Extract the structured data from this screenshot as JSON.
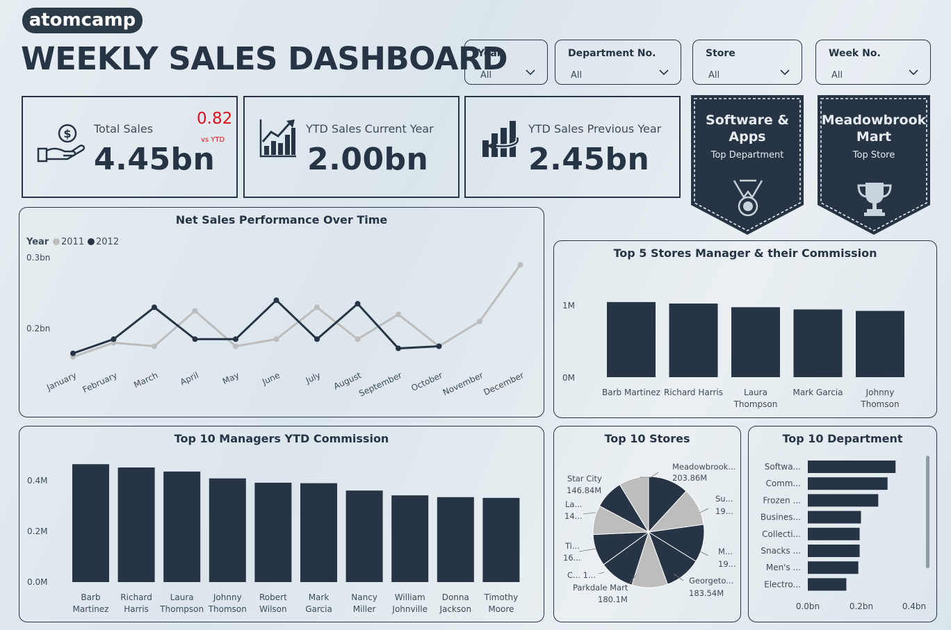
{
  "brand": "atomcamp",
  "title": "WEEKLY SALES DASHBOARD",
  "filters": [
    {
      "label": "Year",
      "value": "All"
    },
    {
      "label": "Department No.",
      "value": "All"
    },
    {
      "label": "Store",
      "value": "All"
    },
    {
      "label": "Week No.",
      "value": "All"
    }
  ],
  "kpis": {
    "total_sales": {
      "label": "Total Sales",
      "value": "4.45bn",
      "ratio": "0.82",
      "ratio_label": "vs YTD",
      "icon": "money-hand-icon"
    },
    "ytd_current": {
      "label": "YTD Sales Current Year",
      "value": "2.00bn",
      "icon": "growth-chart-icon"
    },
    "ytd_previous": {
      "label": "YTD Sales Previous Year",
      "value": "2.45bn",
      "icon": "decline-chart-icon"
    }
  },
  "banners": {
    "top_department": {
      "line1": "Software &",
      "line2": "Apps",
      "subtitle": "Top Department",
      "icon": "medal-icon"
    },
    "top_store": {
      "line1": "Meadowbrook",
      "line2": "Mart",
      "subtitle": "Top Store",
      "icon": "trophy-icon"
    }
  },
  "colors": {
    "dark": "#263445",
    "light": "#bdbdbd",
    "accent_red": "#e0101a"
  },
  "line_panel": {
    "title": "Net Sales Performance Over Time",
    "legend_title": "Year",
    "y_ticks": [
      "0.3bn",
      "0.2bn"
    ]
  },
  "stores5_panel": {
    "title": "Top 5 Stores Manager & their Commission",
    "y_ticks": [
      "1M",
      "0M"
    ],
    "labels": [
      [
        "Barb Martinez"
      ],
      [
        "Richard Harris"
      ],
      [
        "Laura",
        "Thompson"
      ],
      [
        "Mark Garcia"
      ],
      [
        "Johnny",
        "Thomson"
      ]
    ]
  },
  "managers10_panel": {
    "title": "Top 10 Managers YTD Commission",
    "y_ticks": [
      "0.4M",
      "0.2M",
      "0.0M"
    ],
    "labels": [
      [
        "Barb",
        "Martinez"
      ],
      [
        "Richard",
        "Harris"
      ],
      [
        "Laura",
        "Thompson"
      ],
      [
        "Johnny",
        "Thomson"
      ],
      [
        "Robert",
        "Wilson"
      ],
      [
        "Mark",
        "Garcia"
      ],
      [
        "Nancy",
        "Miller"
      ],
      [
        "William",
        "Johnville"
      ],
      [
        "Donna",
        "Jackson"
      ],
      [
        "Timothy",
        "Moore"
      ]
    ]
  },
  "stores10_panel": {
    "title": "Top 10 Stores",
    "slice_labels": [
      [
        "Meadowbrook...",
        "203.86M"
      ],
      [
        "Su...",
        "19..."
      ],
      [
        "M...",
        "19..."
      ],
      [
        "Georgeto...",
        "183.54M"
      ],
      [
        "Parkdale Mart",
        "180.1M"
      ],
      [
        "C... 1...",
        ""
      ],
      [
        "Ti...",
        "16..."
      ],
      [
        "La...",
        "14..."
      ],
      [
        "Star City",
        "146.84M"
      ]
    ]
  },
  "dept10_panel": {
    "title": "Top 10 Department",
    "labels": [
      "Softwa...",
      "Comm...",
      "Frozen ...",
      "Busines...",
      "Collecti...",
      "Snacks ...",
      "Men's ...",
      "Electro..."
    ],
    "x_ticks": [
      "0.0bn",
      "0.2bn",
      "0.4bn"
    ]
  },
  "chart_data": [
    {
      "type": "line",
      "title": "Net Sales Performance Over Time",
      "x": [
        "January",
        "February",
        "March",
        "April",
        "May",
        "June",
        "July",
        "August",
        "September",
        "October",
        "November",
        "December"
      ],
      "ylabel": "",
      "ylim": [
        0.13,
        0.3
      ],
      "legend": "top-left",
      "series": [
        {
          "name": "2011",
          "color": "#bdbdbd",
          "values": [
            0.16,
            0.18,
            0.175,
            0.225,
            0.175,
            0.185,
            0.23,
            0.185,
            0.22,
            0.175,
            0.21,
            0.29
          ]
        },
        {
          "name": "2012",
          "color": "#263445",
          "values": [
            0.165,
            0.185,
            0.23,
            0.185,
            0.185,
            0.24,
            0.185,
            0.235,
            0.172,
            0.175,
            null,
            null
          ]
        }
      ]
    },
    {
      "type": "bar",
      "title": "Top 5 Stores Manager & their Commission",
      "categories": [
        "Barb Martinez",
        "Richard Harris",
        "Laura Thompson",
        "Mark Garcia",
        "Johnny Thomson"
      ],
      "values": [
        1.02,
        1.0,
        0.95,
        0.92,
        0.9
      ],
      "ylim": [
        0,
        1.3
      ]
    },
    {
      "type": "bar",
      "title": "Top 10 Managers YTD Commission",
      "categories": [
        "Barb Martinez",
        "Richard Harris",
        "Laura Thompson",
        "Johnny Thomson",
        "Robert Wilson",
        "Mark Garcia",
        "Nancy Miller",
        "William Johnville",
        "Donna Jackson",
        "Timothy Moore"
      ],
      "values": [
        0.465,
        0.452,
        0.436,
        0.409,
        0.392,
        0.39,
        0.361,
        0.342,
        0.335,
        0.332
      ],
      "ylim": [
        0,
        0.5
      ]
    },
    {
      "type": "pie",
      "title": "Top 10 Stores",
      "categories": [
        "Meadowbrook...",
        "Su...",
        "M...",
        "Georgeto...",
        "Parkdale Mart",
        "C...",
        "Ti...",
        "La...",
        "Star City",
        "(unlabeled)"
      ],
      "values": [
        203.86,
        190,
        190,
        183.54,
        180.1,
        175,
        160,
        147,
        146.84,
        150
      ],
      "colors": [
        "#263445",
        "#bdbdbd",
        "#263445",
        "#263445",
        "#bdbdbd",
        "#263445",
        "#263445",
        "#bdbdbd",
        "#263445",
        "#bdbdbd"
      ]
    },
    {
      "type": "bar",
      "orientation": "horizontal",
      "title": "Top 10 Department",
      "categories": [
        "Softwa...",
        "Comm...",
        "Frozen ...",
        "Busines...",
        "Collecti...",
        "Snacks ...",
        "Men's ...",
        "Electro..."
      ],
      "values": [
        0.33,
        0.3,
        0.265,
        0.2,
        0.195,
        0.195,
        0.19,
        0.145
      ],
      "xlim": [
        0,
        0.45
      ]
    }
  ]
}
